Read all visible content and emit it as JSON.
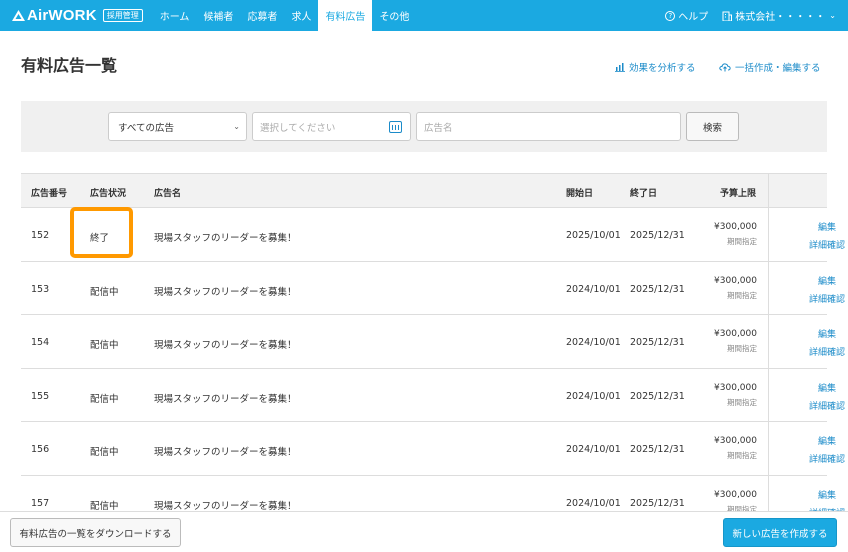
{
  "brand": {
    "logo": "AirWORK",
    "badge": "採用管理"
  },
  "nav": [
    "ホーム",
    "候補者",
    "応募者",
    "求人",
    "有料広告",
    "その他"
  ],
  "nav_active": 4,
  "top_right": {
    "help": "ヘルプ",
    "company": "株式会社・・・・・"
  },
  "page": {
    "title": "有料広告一覧",
    "analyze_link": "効果を分析する",
    "bulk_link": "一括作成・編集する"
  },
  "filter": {
    "select_value": "すべての広告",
    "date_placeholder": "選択してください",
    "name_placeholder": "広告名",
    "search_label": "検索"
  },
  "table": {
    "headers": {
      "id": "広告番号",
      "status": "広告状況",
      "name": "広告名",
      "start": "開始日",
      "end": "終了日",
      "budget": "予算上限"
    },
    "rows": [
      {
        "id": "152",
        "status": "終了",
        "name": "現場スタッフのリーダーを募集！",
        "start": "2025/10/01",
        "end": "2025/12/31",
        "budget": "¥300,000",
        "budget_sub": "期間指定",
        "edit": "編集",
        "detail": "詳細確認"
      },
      {
        "id": "153",
        "status": "配信中",
        "name": "現場スタッフのリーダーを募集！",
        "start": "2024/10/01",
        "end": "2025/12/31",
        "budget": "¥300,000",
        "budget_sub": "期間指定",
        "edit": "編集",
        "detail": "詳細確認"
      },
      {
        "id": "154",
        "status": "配信中",
        "name": "現場スタッフのリーダーを募集！",
        "start": "2024/10/01",
        "end": "2025/12/31",
        "budget": "¥300,000",
        "budget_sub": "期間指定",
        "edit": "編集",
        "detail": "詳細確認"
      },
      {
        "id": "155",
        "status": "配信中",
        "name": "現場スタッフのリーダーを募集！",
        "start": "2024/10/01",
        "end": "2025/12/31",
        "budget": "¥300,000",
        "budget_sub": "期間指定",
        "edit": "編集",
        "detail": "詳細確認"
      },
      {
        "id": "156",
        "status": "配信中",
        "name": "現場スタッフのリーダーを募集！",
        "start": "2024/10/01",
        "end": "2025/12/31",
        "budget": "¥300,000",
        "budget_sub": "期間指定",
        "edit": "編集",
        "detail": "詳細確認"
      },
      {
        "id": "157",
        "status": "配信中",
        "name": "現場スタッフのリーダーを募集！",
        "start": "2024/10/01",
        "end": "2025/12/31",
        "budget": "¥300,000",
        "budget_sub": "期間指定",
        "edit": "編集",
        "detail": "詳細確認"
      }
    ]
  },
  "footer": {
    "download_label": "有料広告の一覧をダウンロードする",
    "new_label": "新しい広告を作成する"
  },
  "colors": {
    "brand": "#1ba9e1",
    "link": "#1b8bc9",
    "highlight": "#ff9900"
  },
  "icons": [
    "airwork-logo-icon",
    "help-icon",
    "building-icon",
    "chevron-down-icon",
    "chart-icon",
    "cloud-upload-icon",
    "calendar-icon"
  ]
}
